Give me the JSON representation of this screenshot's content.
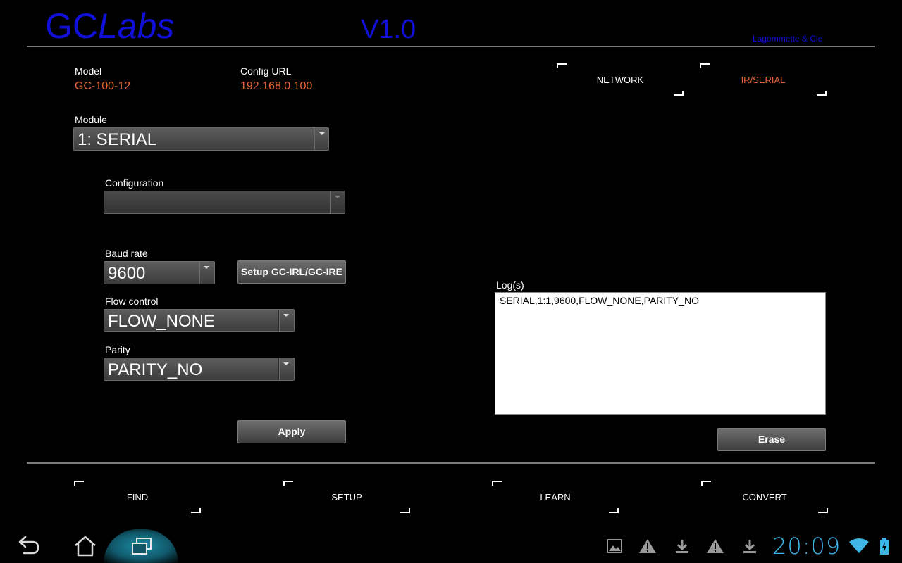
{
  "header": {
    "logo_part1": "GC",
    "logo_part2": "Labs",
    "version": "V1.0",
    "company": "Lagommette & Cie"
  },
  "device": {
    "model_label": "Model",
    "model_value": "GC-100-12",
    "config_url_label": "Config URL",
    "config_url_value": "192.168.0.100"
  },
  "top_tabs": [
    {
      "label": "NETWORK",
      "active": false
    },
    {
      "label": "IR/SERIAL",
      "active": true
    }
  ],
  "form": {
    "module_label": "Module",
    "module_value": "1: SERIAL",
    "configuration_label": "Configuration",
    "configuration_value": "",
    "baud_label": "Baud rate",
    "baud_value": "9600",
    "setup_button": "Setup GC-IRL/GC-IRE",
    "flow_label": "Flow control",
    "flow_value": "FLOW_NONE",
    "parity_label": "Parity",
    "parity_value": "PARITY_NO",
    "apply_button": "Apply"
  },
  "log": {
    "label": "Log(s)",
    "content": "SERIAL,1:1,9600,FLOW_NONE,PARITY_NO",
    "erase_button": "Erase"
  },
  "bottom_tabs": [
    {
      "label": "FIND"
    },
    {
      "label": "SETUP"
    },
    {
      "label": "LEARN"
    },
    {
      "label": "CONVERT"
    }
  ],
  "system_bar": {
    "time": "20:09",
    "icons": [
      "back-icon",
      "home-icon",
      "recent-apps-icon",
      "gallery-icon",
      "warning-icon",
      "download-icon",
      "warning-icon",
      "download-icon",
      "wifi-icon",
      "battery-icon"
    ]
  },
  "colors": {
    "brand_blue": "#1010d8",
    "accent_orange": "#e8653a",
    "clock_blue": "#3fb6e6"
  }
}
